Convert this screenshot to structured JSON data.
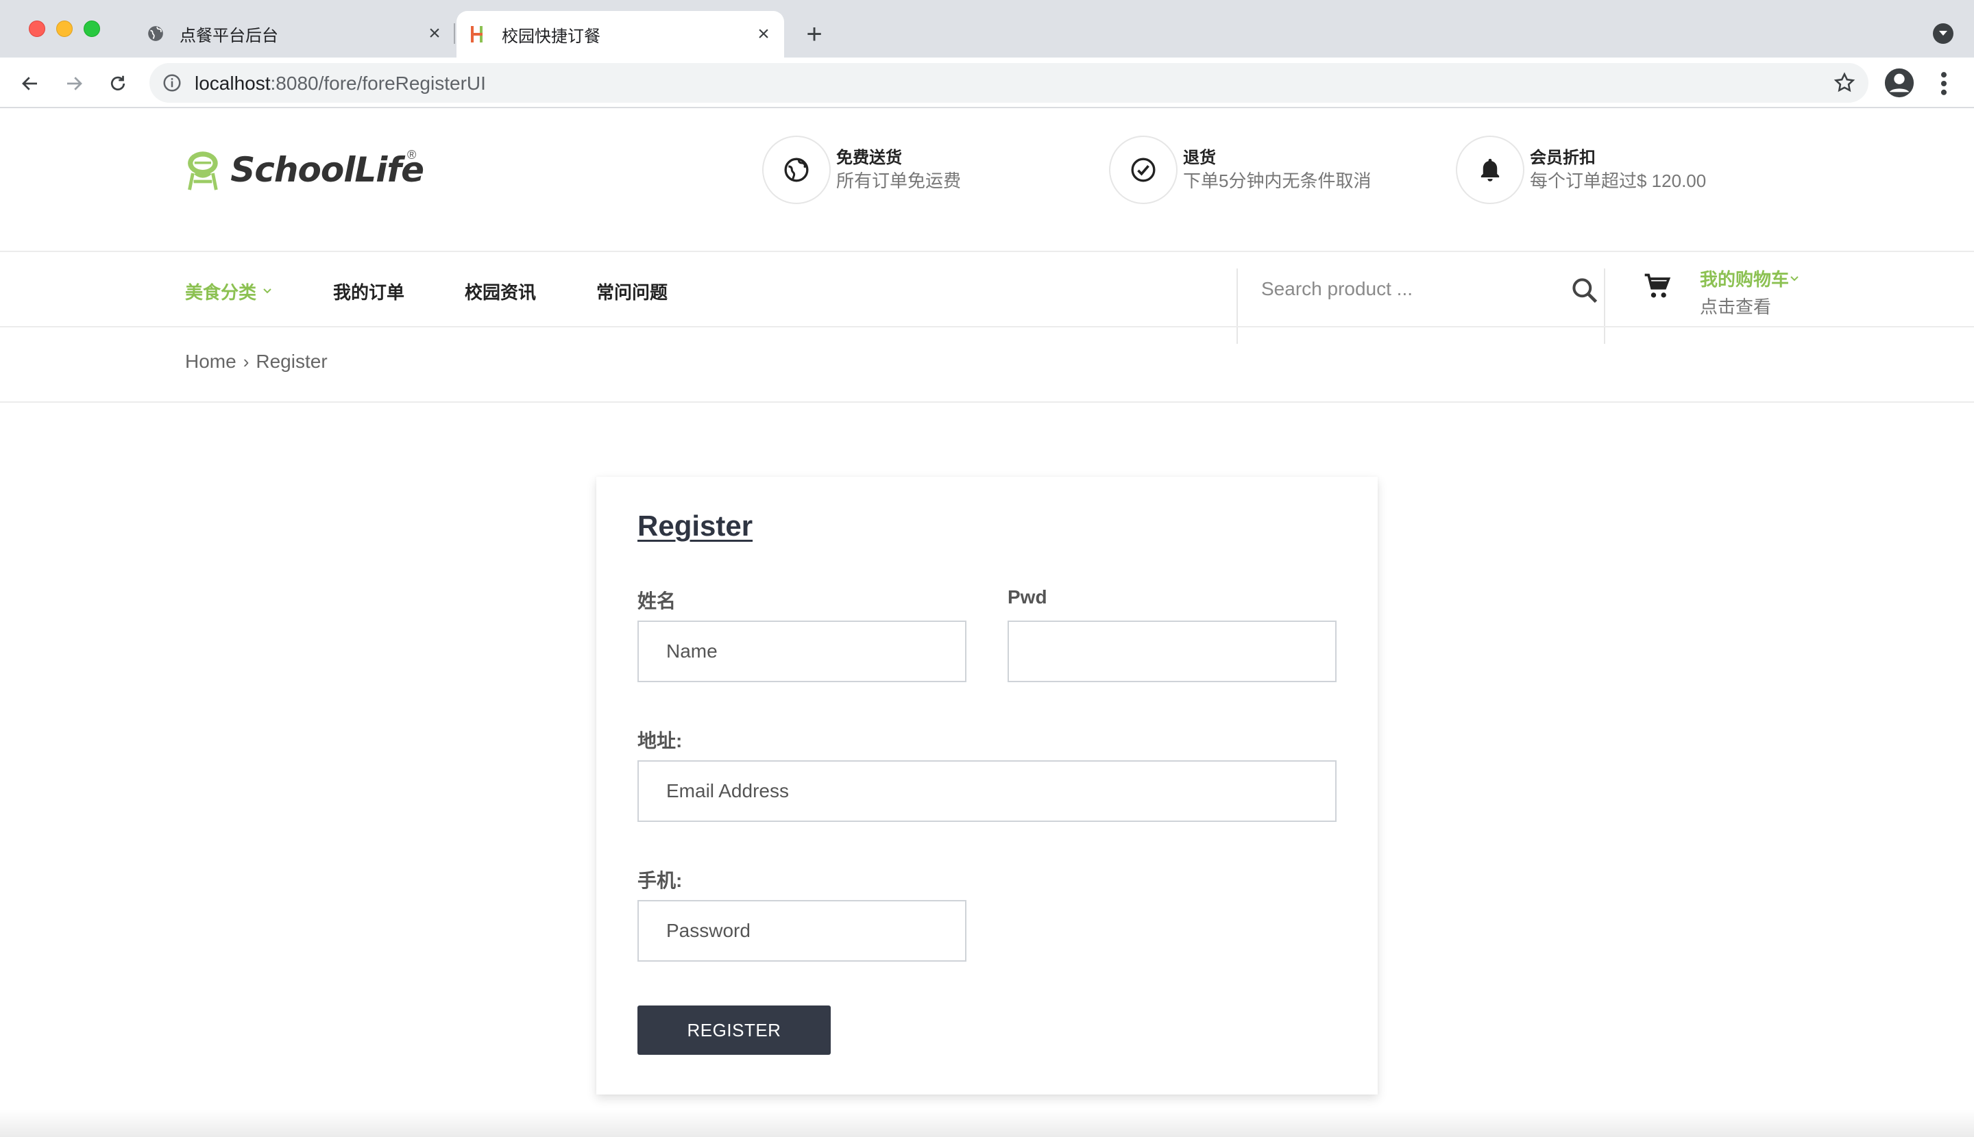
{
  "browser": {
    "tabs": [
      {
        "title": "点餐平台后台",
        "icon": "globe-icon",
        "active": false
      },
      {
        "title": "校园快捷订餐",
        "icon": "site-favicon",
        "active": true
      }
    ],
    "url_host": "localhost",
    "url_rest": ":8080/fore/foreRegisterUI"
  },
  "header": {
    "logo_text": "SchoolLife",
    "logo_mark": "®",
    "features": [
      {
        "icon": "globe-icon",
        "title": "免费送货",
        "desc": "所有订单免运费"
      },
      {
        "icon": "check-circle-icon",
        "title": "退货",
        "desc": "下单5分钟内无条件取消"
      },
      {
        "icon": "bell-icon",
        "title": "会员折扣",
        "desc": "每个订单超过$ 120.00"
      }
    ]
  },
  "nav": {
    "items": [
      {
        "label": "美食分类",
        "accent": true,
        "dropdown": true
      },
      {
        "label": "我的订单"
      },
      {
        "label": "校园资讯"
      },
      {
        "label": "常问问题"
      }
    ],
    "search_placeholder": "Search product ...",
    "cart_title": "我的购物车",
    "cart_sub": "点击查看"
  },
  "breadcrumb": {
    "home": "Home",
    "current": "Register"
  },
  "form": {
    "title": "Register",
    "name_label": "姓名",
    "name_placeholder": "Name",
    "pwd_label": "Pwd",
    "pwd_placeholder": "",
    "address_label": "地址:",
    "address_placeholder": "Email Address",
    "phone_label": "手机:",
    "phone_placeholder": "Password",
    "submit_label": "REGISTER"
  },
  "colors": {
    "accent": "#8cc152",
    "button": "#343a47",
    "chrome": "#dee1e6"
  }
}
